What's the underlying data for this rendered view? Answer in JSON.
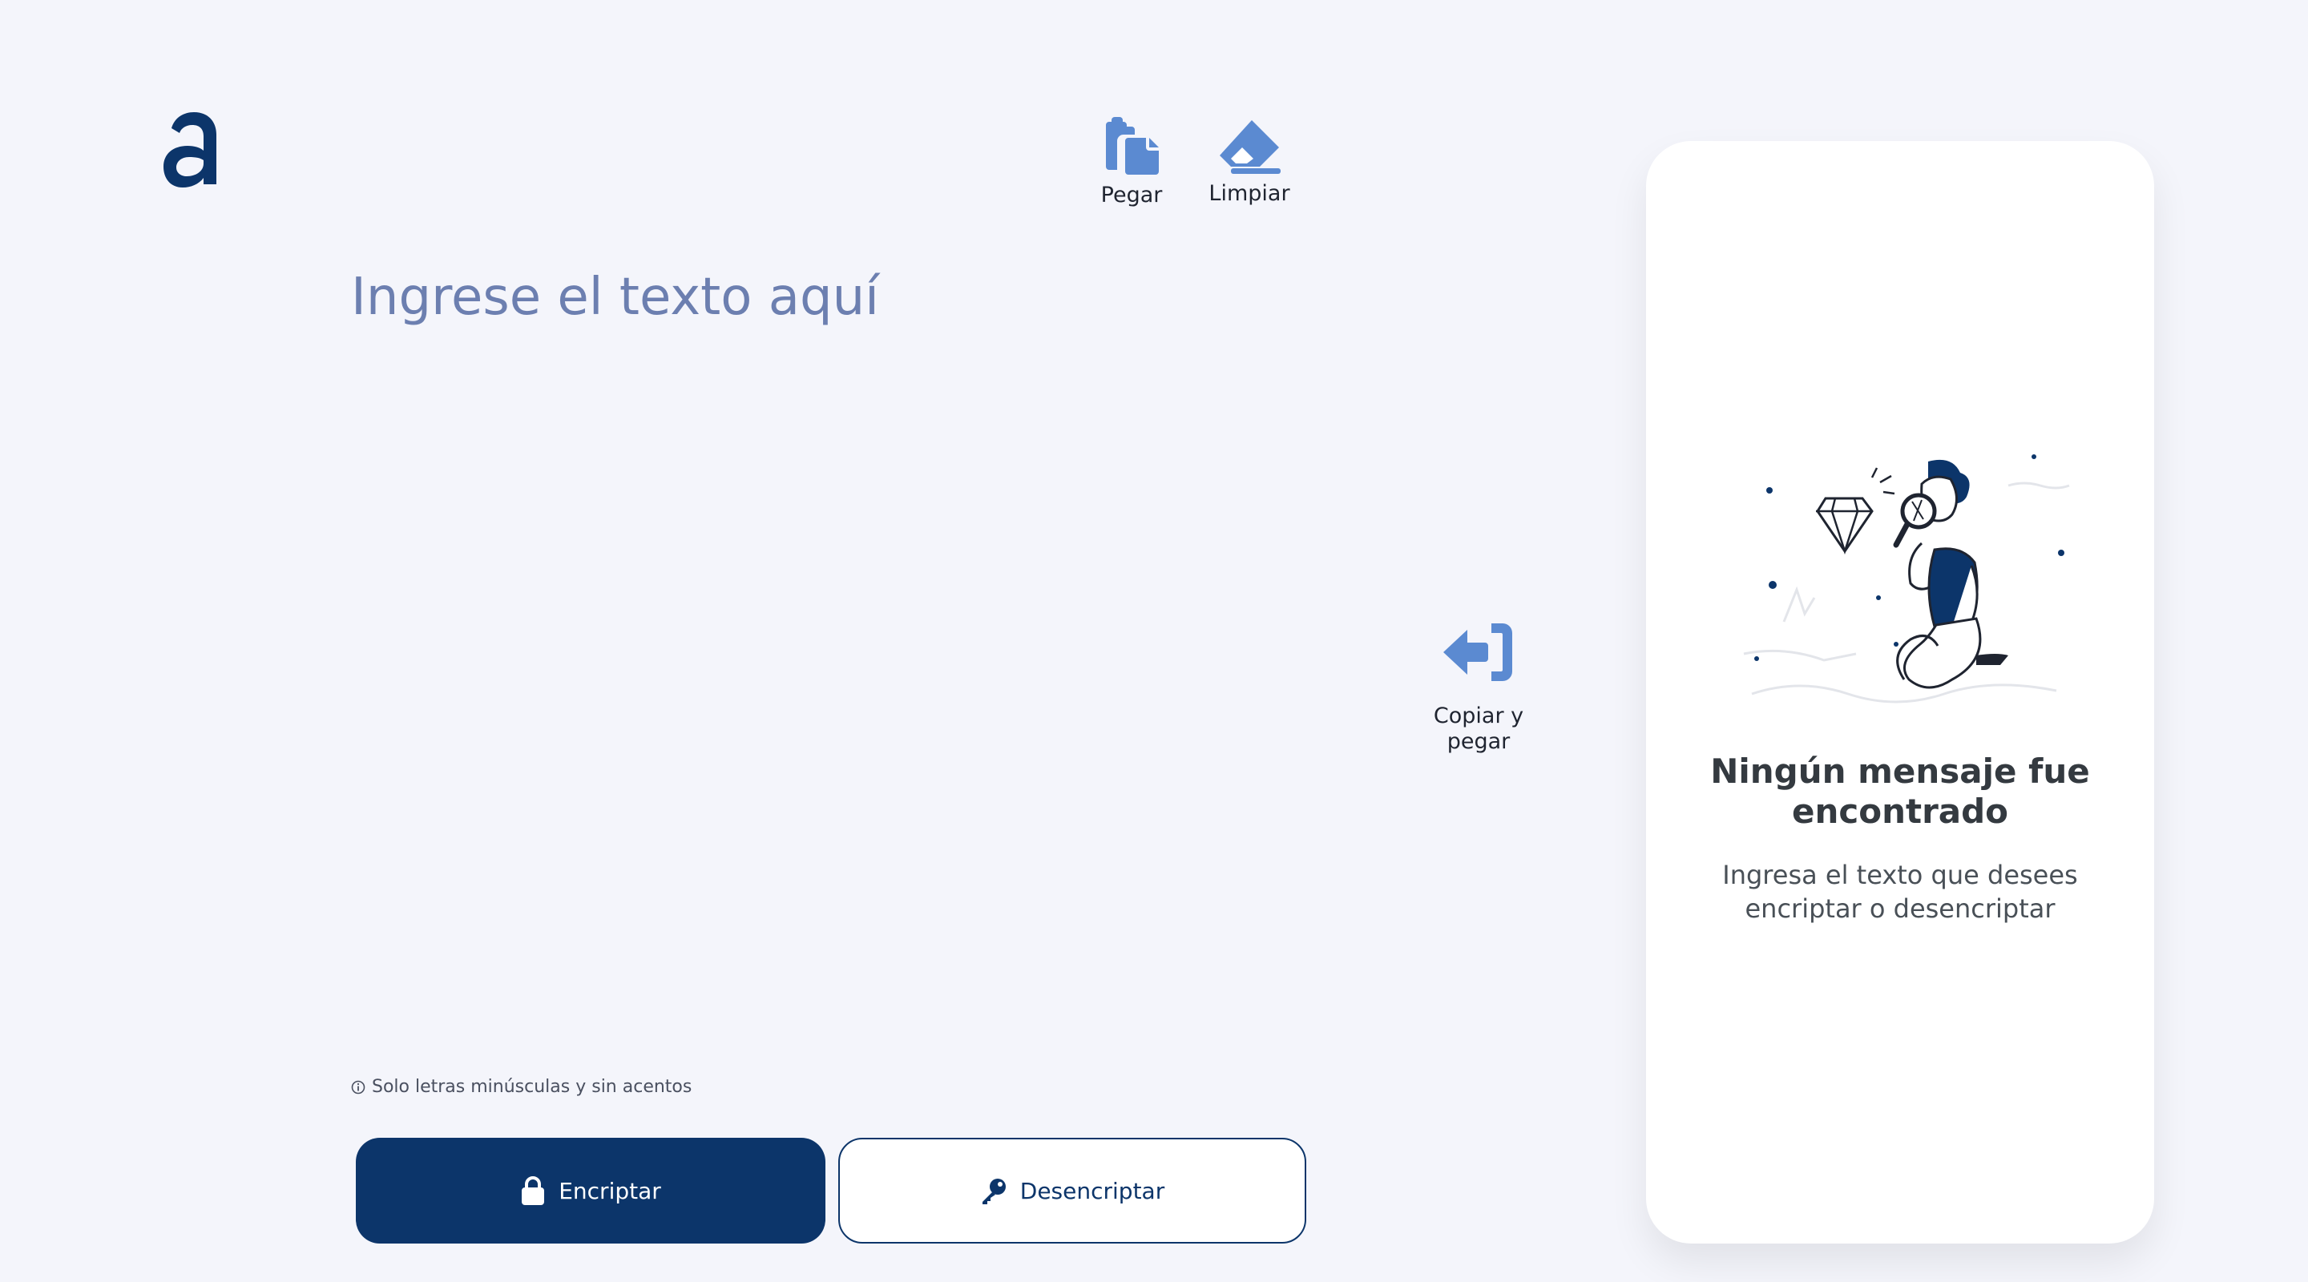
{
  "header": {
    "logo": {
      "icon": "alura-a-logo-icon",
      "color": "#0c356a"
    }
  },
  "toolbar": {
    "paste_label": "Pegar",
    "paste_icon": "clipboard-icon",
    "clear_label": "Limpiar",
    "clear_icon": "eraser-icon",
    "icon_color": "#5b8ad1"
  },
  "editor": {
    "placeholder": "Ingrese el texto aquí",
    "value": ""
  },
  "copy_action": {
    "label": "Copiar y pegar",
    "icon": "arrow-into-bracket-icon"
  },
  "hint": {
    "icon": "info-icon",
    "text": "Solo letras minúsculas y sin acentos"
  },
  "actions": {
    "encrypt_label": "Encriptar",
    "encrypt_icon": "lock-icon",
    "decrypt_label": "Desencriptar",
    "decrypt_icon": "key-icon",
    "primary_color": "#0c356a"
  },
  "result": {
    "illustration": "person-with-magnifying-glass-illustration",
    "title": "Ningún mensaje fue encontrado",
    "message": "Ingresa el texto que desees encriptar o desencriptar"
  }
}
